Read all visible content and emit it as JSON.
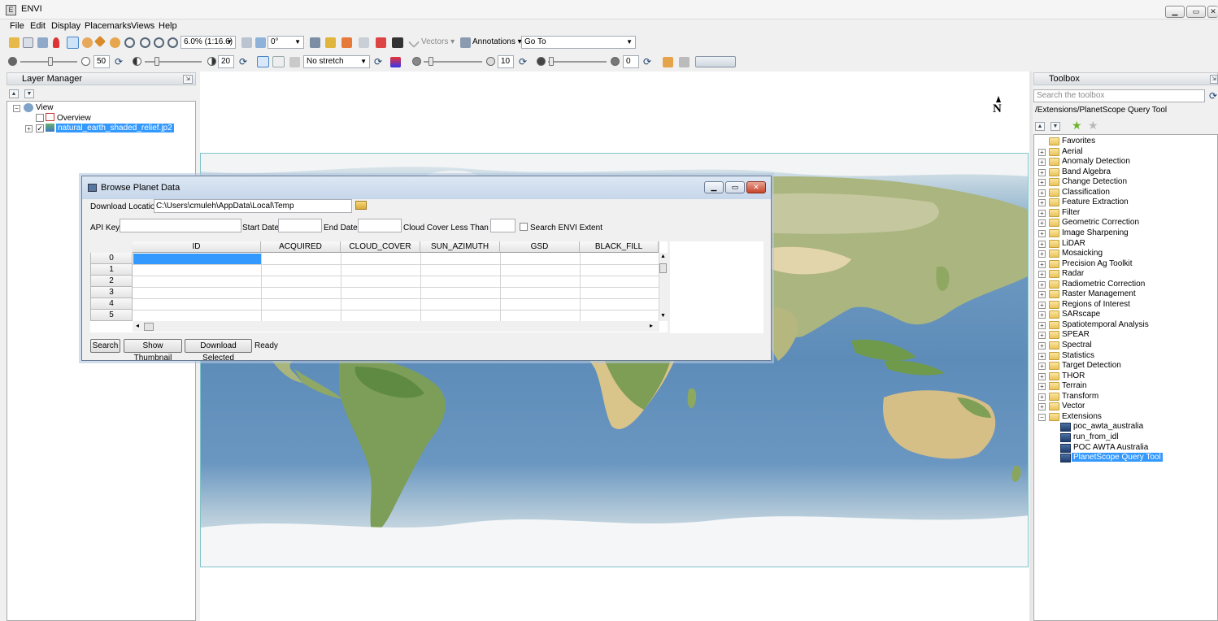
{
  "window": {
    "title": "ENVI",
    "icon": "envi-logo-icon"
  },
  "menu": [
    "File",
    "Edit",
    "Display",
    "Placemarks",
    "Views",
    "Help"
  ],
  "toolbar": {
    "zoom_value": "6.0% (1:16.6)",
    "rotation_value": "0°",
    "vectors_label": "Vectors",
    "annotations_label": "Annotations",
    "goto_label": "Go To",
    "brightness_value": "50",
    "contrast_value": "20",
    "stretch_value": "No stretch",
    "sharpen_value": "10",
    "transparency_value": "0"
  },
  "layer_manager": {
    "title": "Layer Manager",
    "tree": {
      "root": "View",
      "children": [
        "Overview",
        "natural_earth_shaded_relief.jp2"
      ],
      "selected": "natural_earth_shaded_relief.jp2"
    }
  },
  "map": {
    "north_arrow": "N"
  },
  "dialog": {
    "title": "Browse Planet Data",
    "download_location_label": "Download Location:",
    "download_location_value": "C:\\Users\\cmuleh\\AppData\\Local\\Temp",
    "api_key_label": "API Key:",
    "start_date_label": "Start Date:",
    "end_date_label": "End Date:",
    "cloud_cover_label": "Cloud Cover Less Than (%):",
    "search_extent_label": "Search ENVI Extent",
    "columns": [
      "ID",
      "ACQUIRED",
      "CLOUD_COVER",
      "SUN_AZIMUTH",
      "GSD",
      "BLACK_FILL"
    ],
    "rows": [
      "0",
      "1",
      "2",
      "3",
      "4",
      "5"
    ],
    "search_button": "Search",
    "thumbnail_button": "Show Thumbnail",
    "download_button": "Download Selected",
    "status": "Ready"
  },
  "toolbox": {
    "title": "Toolbox",
    "search_placeholder": "Search the toolbox",
    "path": "/Extensions/PlanetScope Query Tool",
    "folders": [
      "Favorites",
      "Aerial",
      "Anomaly Detection",
      "Band Algebra",
      "Change Detection",
      "Classification",
      "Feature Extraction",
      "Filter",
      "Geometric Correction",
      "Image Sharpening",
      "LiDAR",
      "Mosaicking",
      "Precision Ag Toolkit",
      "Radar",
      "Radiometric Correction",
      "Raster Management",
      "Regions of Interest",
      "SARscape",
      "Spatiotemporal Analysis",
      "SPEAR",
      "Spectral",
      "Statistics",
      "Target Detection",
      "THOR",
      "Terrain",
      "Transform",
      "Vector",
      "Extensions"
    ],
    "extensions": [
      "poc_awta_australia",
      "run_from_idl",
      "POC AWTA Australia",
      "PlanetScope Query Tool"
    ],
    "selected": "PlanetScope Query Tool"
  }
}
